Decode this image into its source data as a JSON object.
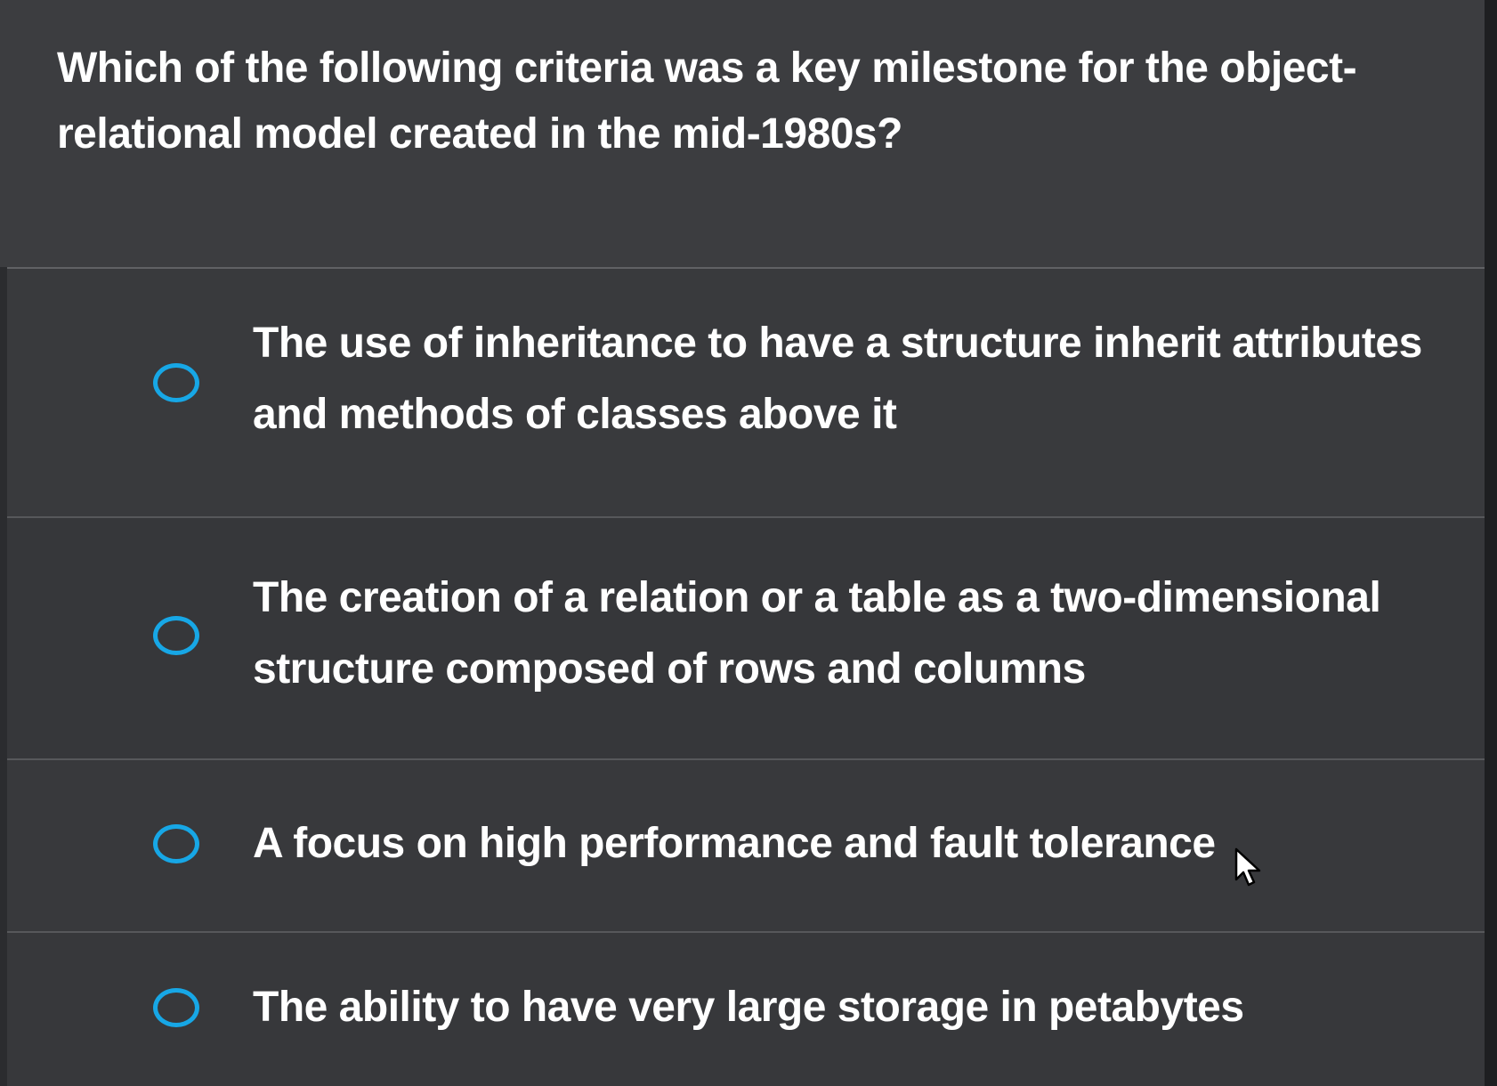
{
  "question": {
    "text": "Which of the following criteria was a key milestone for the object-relational model created in the mid-1980s?"
  },
  "options": [
    {
      "label": "The use of inheritance to have a structure inherit attributes and methods of classes above it",
      "selected": false
    },
    {
      "label": "The creation of a relation or a table as a two-dimensional structure composed of rows and columns",
      "selected": false
    },
    {
      "label": "A focus on high performance and fault tolerance",
      "selected": false
    },
    {
      "label": "The ability to have very large storage in petabytes",
      "selected": false
    }
  ],
  "colors": {
    "radio_ring": "#17a7e6",
    "text": "#ffffff",
    "background": "#38393c"
  },
  "icons": {
    "pointer": "mouse-pointer-icon",
    "radio": "radio-circle-icon"
  }
}
